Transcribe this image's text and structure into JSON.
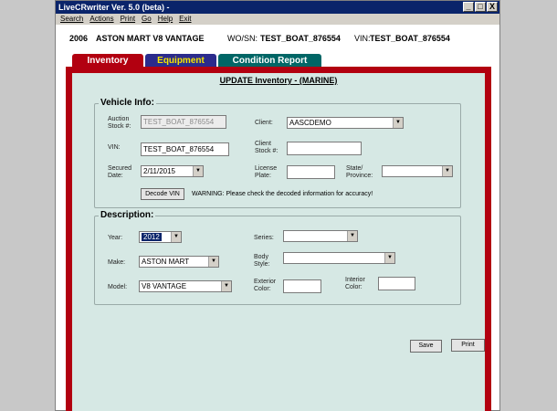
{
  "window": {
    "title": "LiveCRwriter Ver. 5.0 (beta) -",
    "controls": [
      "_",
      "□",
      "X"
    ]
  },
  "menu": [
    "Search",
    "Actions",
    "Print",
    "Go",
    "Help",
    "Exit"
  ],
  "header": {
    "year": "2006",
    "make_model": "ASTON MART V8 VANTAGE",
    "wo_label": "WO/SN:",
    "wo_value": "TEST_BOAT_876554",
    "vin_label": "VIN:",
    "vin_value": "TEST_BOAT_876554"
  },
  "tabs": [
    {
      "label": "Inventory",
      "active": true
    },
    {
      "label": "Equipment",
      "active": false
    },
    {
      "label": "Condition Report",
      "active": false
    }
  ],
  "page_title": "UPDATE Inventory - (MARINE)",
  "vehicle_info": {
    "legend": "Vehicle Info:",
    "auction_stock_label": "Auction Stock #:",
    "auction_stock_value": "TEST_BOAT_876554",
    "client_label": "Client:",
    "client_value": "AASCDEMO",
    "vin_label": "VIN:",
    "vin_value": "TEST_BOAT_876554",
    "client_stock_label": "Client Stock #:",
    "client_stock_value": "",
    "secured_date_label": "Secured Date:",
    "secured_date_value": "2/11/2015",
    "license_plate_label": "License Plate:",
    "license_plate_value": "",
    "state_label": "State/ Province:",
    "state_value": "",
    "decode_button": "Decode VIN",
    "warning": "WARNING: Please check the decoded information for accuracy!"
  },
  "description": {
    "legend": "Description:",
    "year_label": "Year:",
    "year_value": "2012",
    "series_label": "Series:",
    "series_value": "",
    "make_label": "Make:",
    "make_value": "ASTON MART",
    "body_style_label": "Body Style:",
    "body_style_value": "",
    "model_label": "Model:",
    "model_value": "V8 VANTAGE",
    "exterior_color_label": "Exterior Color:",
    "exterior_color_value": "",
    "interior_color_label": "Interior Color:",
    "interior_color_value": ""
  },
  "actions": {
    "save": "Save",
    "print": "Print"
  }
}
